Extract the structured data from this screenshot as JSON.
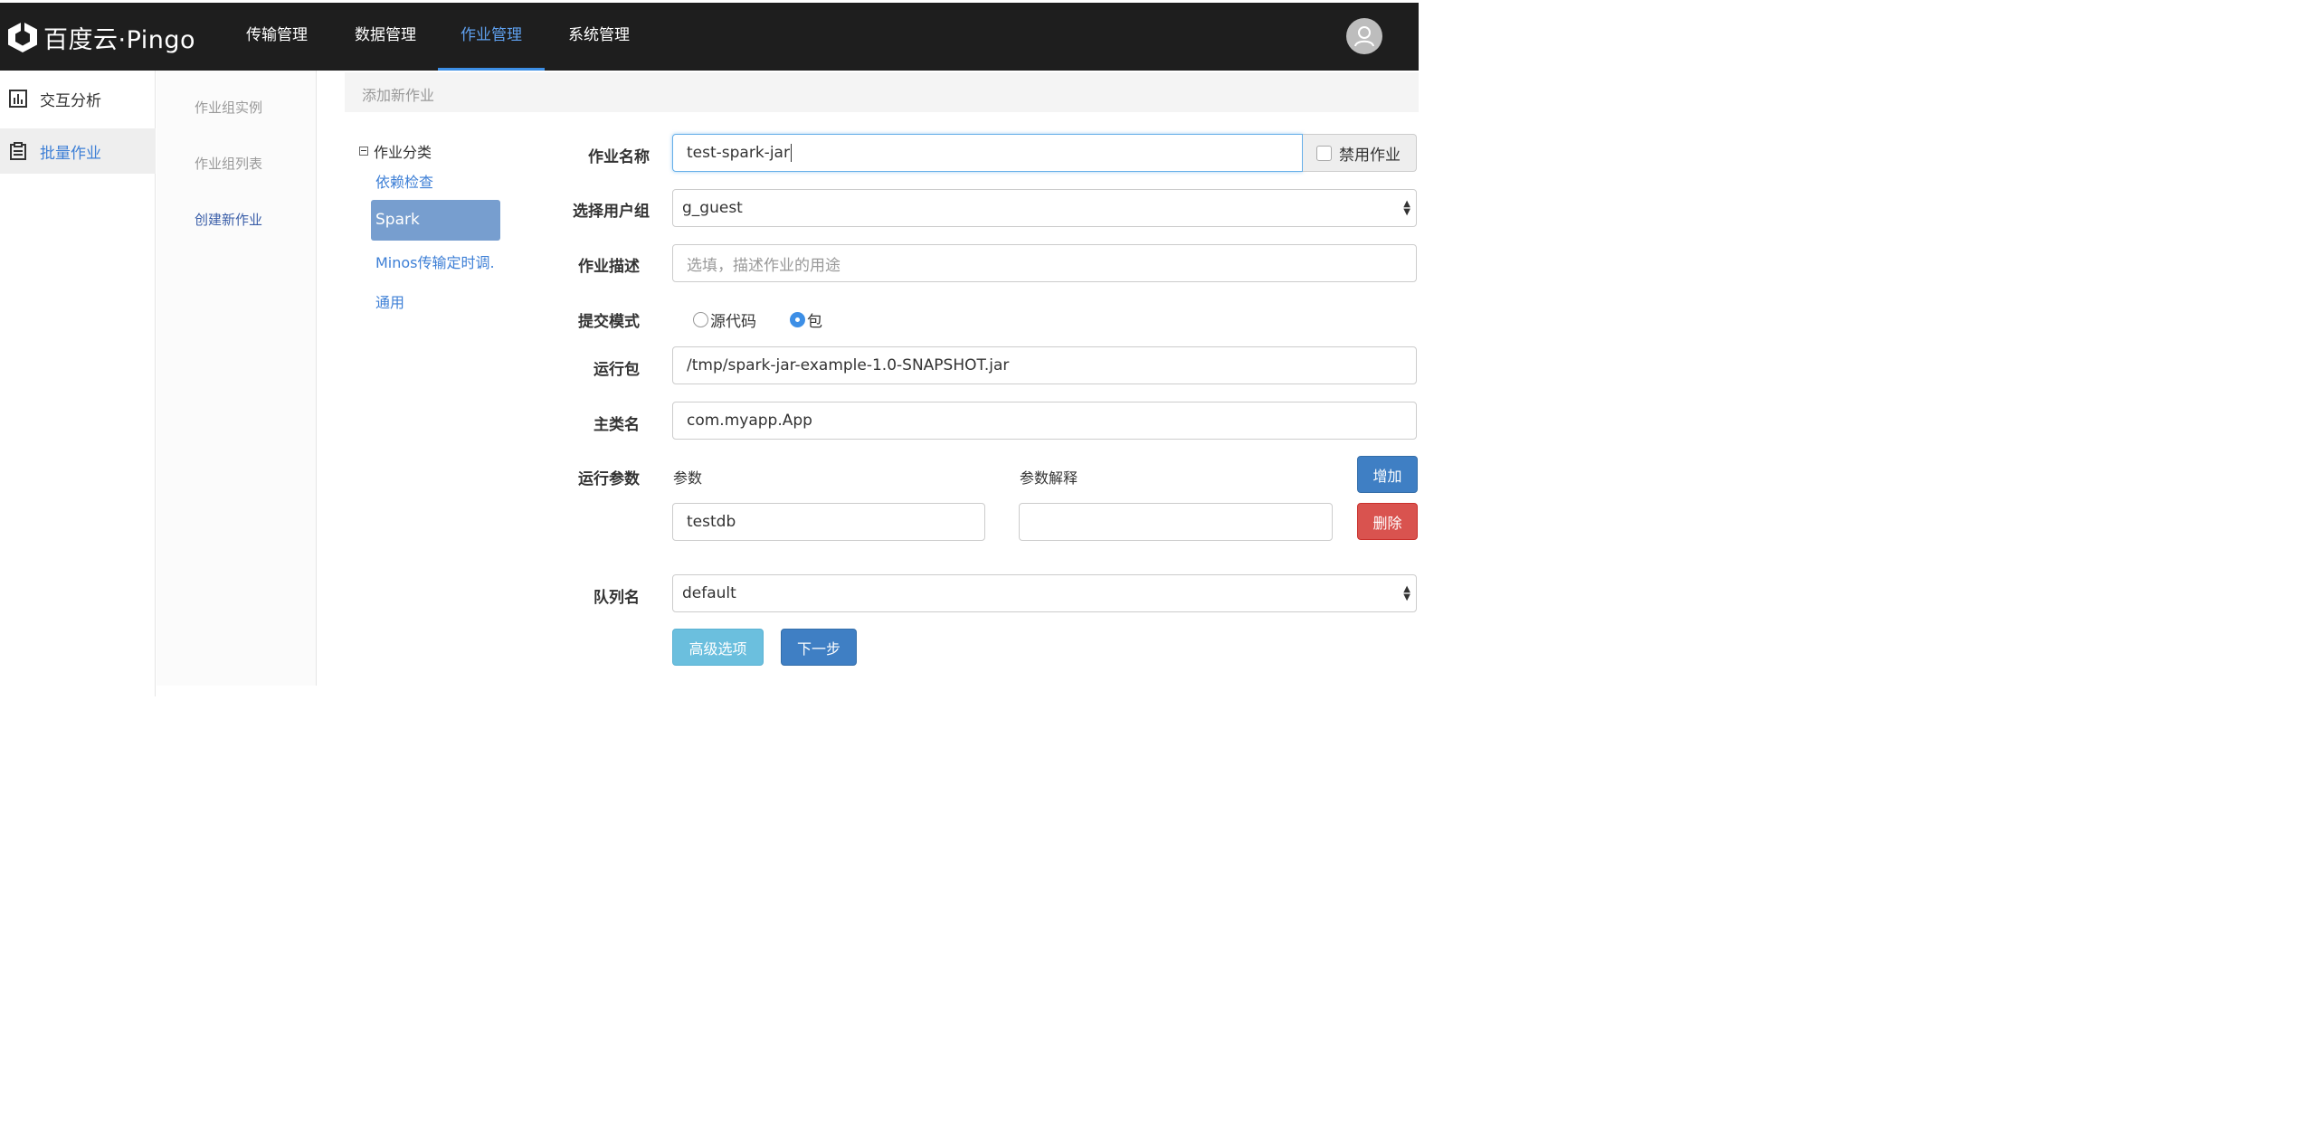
{
  "app": {
    "logo_text": "百度云·Pingo"
  },
  "topnav": {
    "items": [
      {
        "label": "传输管理"
      },
      {
        "label": "数据管理"
      },
      {
        "label": "作业管理"
      },
      {
        "label": "系统管理"
      }
    ],
    "active": "作业管理",
    "active_color": "#5fa0ee"
  },
  "sidebar": {
    "items": [
      {
        "label": "交互分析",
        "icon": "bar-chart-icon"
      },
      {
        "label": "批量作业",
        "icon": "clipboard-icon"
      }
    ],
    "active": "批量作业"
  },
  "submenu": {
    "items": [
      {
        "label": "作业组实例"
      },
      {
        "label": "作业组列表"
      },
      {
        "label": "创建新作业"
      }
    ],
    "active": "创建新作业"
  },
  "breadcrumb": {
    "label": "添加新作业"
  },
  "categories": {
    "header": "作业分类",
    "items": [
      {
        "label": "依赖检查"
      },
      {
        "label": "Spark"
      },
      {
        "label": "Minos传输定时调."
      },
      {
        "label": "通用"
      }
    ],
    "selected": "Spark"
  },
  "form": {
    "job_name": {
      "label": "作业名称",
      "value": "test-spark-jar"
    },
    "disable_job": {
      "label": "禁用作业",
      "checked": false
    },
    "user_group": {
      "label": "选择用户组",
      "value": "g_guest"
    },
    "description": {
      "label": "作业描述",
      "placeholder": "选填，描述作业的用途",
      "value": ""
    },
    "submit_mode": {
      "label": "提交模式",
      "options": [
        {
          "label": "源代码",
          "checked": false
        },
        {
          "label": "包",
          "checked": true
        }
      ]
    },
    "package": {
      "label": "运行包",
      "value": "/tmp/spark-jar-example-1.0-SNAPSHOT.jar"
    },
    "main_class": {
      "label": "主类名",
      "value": "com.myapp.App"
    },
    "run_params": {
      "label": "运行参数",
      "col_param": "参数",
      "col_desc": "参数解释",
      "rows": [
        {
          "param": "testdb",
          "desc": ""
        }
      ],
      "add_label": "增加",
      "delete_label": "删除"
    },
    "queue": {
      "label": "队列名",
      "value": "default"
    },
    "advanced_label": "高级选项",
    "next_label": "下一步"
  },
  "colors": {
    "topbar": "#1e1e1e",
    "primary": "#3f7fc4",
    "danger": "#d9534f",
    "info": "#6bbfde",
    "selected_category": "#779ecf"
  }
}
